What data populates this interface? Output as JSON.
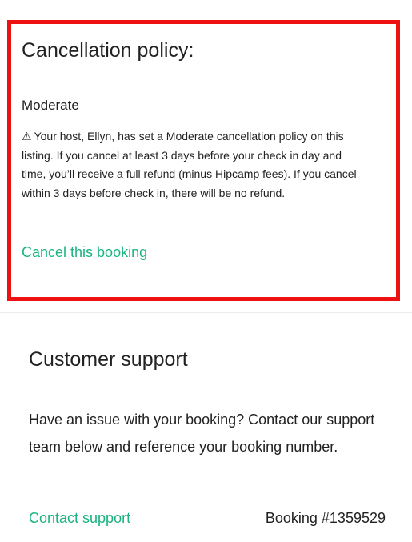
{
  "cancellation": {
    "title": "Cancellation policy:",
    "policy_name": "Moderate",
    "warning_icon": "⚠",
    "policy_text": "Your host, Ellyn, has set a Moderate cancellation policy on this listing. If you cancel at least 3 days before your check in day and time, you’ll receive a full refund (minus Hipcamp fees). If you cancel within 3 days before check in, there will be no refund.",
    "cancel_link": "Cancel this booking"
  },
  "support": {
    "title": "Customer support",
    "text": "Have an issue with your booking? Contact our support team below and reference your booking number.",
    "contact_link": "Contact support",
    "booking_number": "Booking #1359529"
  },
  "colors": {
    "accent": "#1ab482",
    "highlight_border": "#ee1111",
    "text": "#222222"
  }
}
